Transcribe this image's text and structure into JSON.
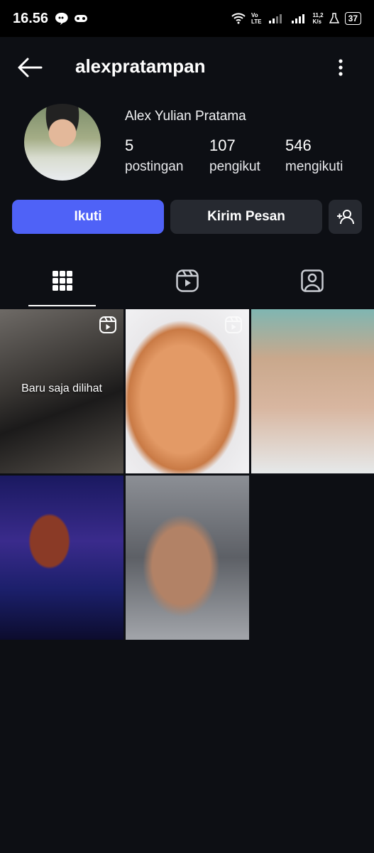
{
  "status_bar": {
    "time": "16.56",
    "network_top": "Vo",
    "network_bottom": "LTE",
    "speed_top": "11,2",
    "speed_bottom": "K/s",
    "battery": "37"
  },
  "header": {
    "username": "alexpratampan"
  },
  "profile": {
    "full_name": "Alex Yulian Pratama",
    "stats": [
      {
        "value": "5",
        "label": "postingan"
      },
      {
        "value": "107",
        "label": "pengikut"
      },
      {
        "value": "546",
        "label": "mengikuti"
      }
    ]
  },
  "actions": {
    "follow_label": "Ikuti",
    "message_label": "Kirim Pesan"
  },
  "tabs": [
    "grid-icon",
    "reels-icon",
    "tagged-icon"
  ],
  "grid": {
    "recently_viewed_label": "Baru saja dilihat"
  },
  "colors": {
    "background": "#0d0f14",
    "accent": "#4f62f7",
    "secondary_button": "#262930"
  }
}
